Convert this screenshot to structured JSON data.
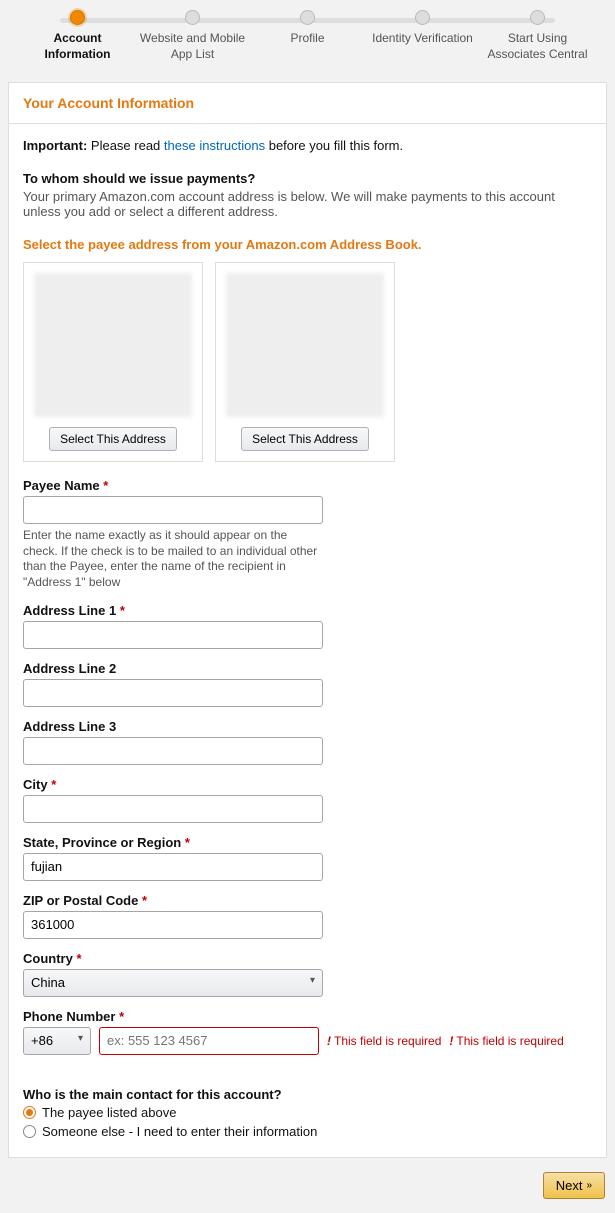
{
  "stepper": {
    "steps": [
      {
        "label": "Account Information",
        "active": true
      },
      {
        "label": "Website and Mobile App List",
        "active": false
      },
      {
        "label": "Profile",
        "active": false
      },
      {
        "label": "Identity Verification",
        "active": false
      },
      {
        "label": "Start Using Associates Central",
        "active": false
      }
    ]
  },
  "panel": {
    "title": "Your Account Information"
  },
  "note": {
    "important_label": "Important:",
    "before": "Please read",
    "link": "these instructions",
    "after": "before you fill this form."
  },
  "payments": {
    "question": "To whom should we issue payments?",
    "desc": "Your primary Amazon.com account address is below. We will make payments to this account unless you add or select a different address."
  },
  "address_book": {
    "heading": "Select the payee address from your Amazon.com Address Book.",
    "select_btn": "Select This Address"
  },
  "form": {
    "payee_name": {
      "label": "Payee Name",
      "value": "",
      "help": "Enter the name exactly as it should appear on the check. If the check is to be mailed to an individual other than the Payee, enter the name of the recipient in \"Address 1\" below"
    },
    "addr1": {
      "label": "Address Line 1",
      "value": ""
    },
    "addr2": {
      "label": "Address Line 2",
      "value": ""
    },
    "addr3": {
      "label": "Address Line 3",
      "value": ""
    },
    "city": {
      "label": "City",
      "value": ""
    },
    "state": {
      "label": "State, Province or Region",
      "value": "fujian"
    },
    "zip": {
      "label": "ZIP or Postal Code",
      "value": "361000"
    },
    "country": {
      "label": "Country",
      "value": "China"
    },
    "phone": {
      "label": "Phone Number",
      "code": "+86",
      "placeholder": "ex: 555 123 4567",
      "error": "This field is required"
    }
  },
  "contact": {
    "question": "Who is the main contact for this account?",
    "opt1": "The payee listed above",
    "opt2": "Someone else - I need to enter their information"
  },
  "footer": {
    "next": "Next"
  }
}
